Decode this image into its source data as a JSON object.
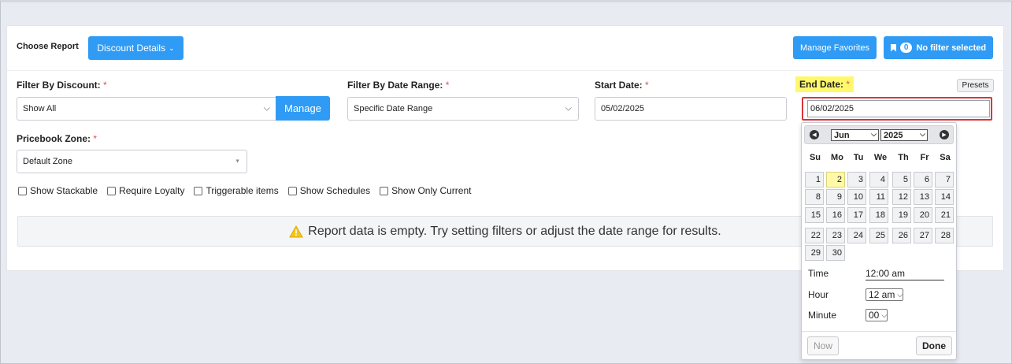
{
  "header": {
    "choose_report_label": "Choose Report",
    "report_button": "Discount Details",
    "manage_favorites": "Manage Favorites",
    "filter_count": "0",
    "filter_status": "No filter selected"
  },
  "filters": {
    "discount": {
      "label": "Filter By Discount:",
      "required": "*",
      "value": "Show All",
      "manage_button": "Manage"
    },
    "date_range": {
      "label": "Filter By Date Range:",
      "required": "*",
      "value": "Specific Date Range"
    },
    "start_date": {
      "label": "Start Date:",
      "required": "*",
      "value": "05/02/2025"
    },
    "end_date": {
      "label": "End Date:",
      "required": "*",
      "value": "06/02/2025",
      "presets_button": "Presets"
    },
    "pricebook": {
      "label": "Pricebook Zone:",
      "required": "*",
      "value": "Default Zone"
    }
  },
  "checkboxes": [
    "Show Stackable",
    "Require Loyalty",
    "Triggerable items",
    "Show Schedules",
    "Show Only Current"
  ],
  "empty_message": "Report data is empty. Try setting filters or adjust the date range for results.",
  "calendar": {
    "month": "Jun",
    "year": "2025",
    "weekdays": [
      "Su",
      "Mo",
      "Tu",
      "We",
      "Th",
      "Fr",
      "Sa"
    ],
    "days": [
      "1",
      "2",
      "3",
      "4",
      "5",
      "6",
      "7",
      "8",
      "9",
      "10",
      "11",
      "12",
      "13",
      "14",
      "15",
      "16",
      "17",
      "18",
      "19",
      "20",
      "21",
      "22",
      "23",
      "24",
      "25",
      "26",
      "27",
      "28",
      "29",
      "30"
    ],
    "selected_day": "2",
    "time_label": "Time",
    "time_value": "12:00 am",
    "hour_label": "Hour",
    "hour_value": "12 am",
    "minute_label": "Minute",
    "minute_value": "00",
    "now_button": "Now",
    "done_button": "Done"
  },
  "colors": {
    "primary": "#2f9bf4",
    "highlight": "#fff9a8",
    "required": "#d9534f",
    "focus_border": "#d9353a",
    "warning": "#f5c518"
  }
}
